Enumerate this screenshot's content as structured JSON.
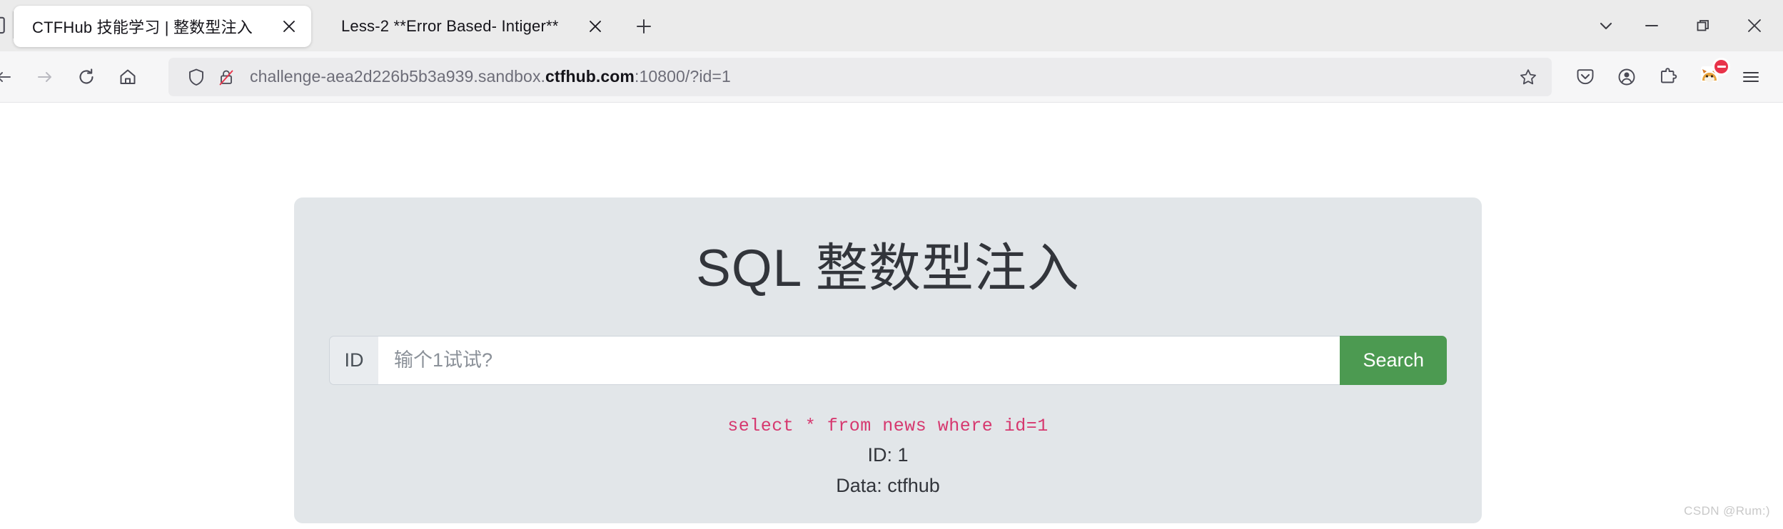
{
  "browser": {
    "tabs": [
      {
        "title": "CTFHub 技能学习 | 整数型注入",
        "active": true
      },
      {
        "title": "Less-2 **Error Based- Intiger**",
        "active": false
      }
    ],
    "new_tab_label": "+",
    "window_controls": {
      "list_all_tabs": "list-all-tabs",
      "minimize": "minimize",
      "restore": "restore",
      "close": "close"
    },
    "nav": {
      "back": "back",
      "forward": "forward",
      "reload": "reload",
      "home": "home"
    },
    "url_bar": {
      "url_prefix": "challenge-aea2d226b5b3a939.sandbox.",
      "url_host_strong": "ctfhub.com",
      "url_suffix": ":10800/?id=1",
      "full_url": "challenge-aea2d226b5b3a939.sandbox.ctfhub.com:10800/?id=1",
      "shield_icon": "shield-icon",
      "insecure_icon": "broken-lock-icon",
      "bookmark_icon": "star-outline-icon"
    },
    "toolbar": {
      "pocket": "save-to-pocket",
      "account": "account",
      "extensions": "extensions",
      "profile": "firefox-profile-avatar",
      "app_menu": "application-menu"
    }
  },
  "page": {
    "title": "SQL 整数型注入",
    "form": {
      "prefix_label": "ID",
      "input_value": "",
      "input_placeholder": "输个1试试?",
      "submit_label": "Search"
    },
    "result": {
      "sql_query": "select * from news where id=1",
      "id_line": "ID: 1",
      "data_line": "Data: ctfhub"
    }
  },
  "watermark": "CSDN @Rum:)",
  "colors": {
    "panel_bg": "#e2e6e9",
    "search_green": "#4c9a51",
    "sql_pink": "#d6386f",
    "chrome_bg": "#ebebeb",
    "navbar_bg": "#f6f6f7",
    "urlbar_bg": "#ebebed"
  }
}
